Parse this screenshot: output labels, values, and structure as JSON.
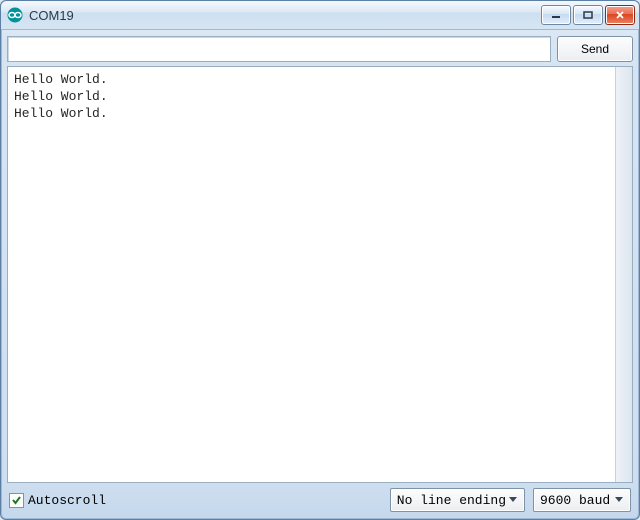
{
  "window": {
    "title": "COM19"
  },
  "toolbar": {
    "send_label": "Send"
  },
  "input": {
    "value": "",
    "placeholder": ""
  },
  "output": {
    "lines": [
      "Hello World.",
      "Hello World.",
      "Hello World."
    ]
  },
  "footer": {
    "autoscroll_label": "Autoscroll",
    "autoscroll_checked": true,
    "line_ending_selected": "No line ending",
    "baud_selected": "9600 baud"
  }
}
